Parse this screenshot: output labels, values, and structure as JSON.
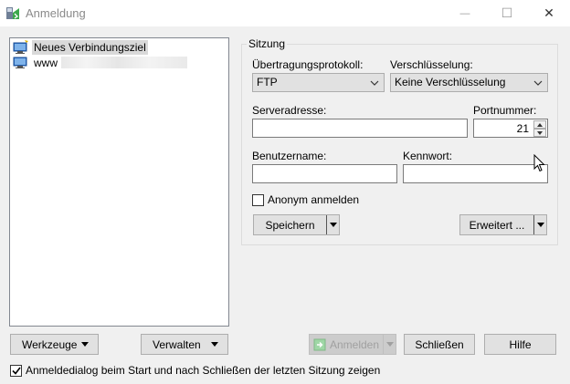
{
  "window": {
    "title": "Anmeldung",
    "minimize_glyph": "—",
    "maximize_glyph": "☐",
    "close_glyph": "✕"
  },
  "site_tree": {
    "items": [
      {
        "label": "Neues Verbindungsziel",
        "icon": "new-site-icon",
        "selected": true
      },
      {
        "label": "www",
        "icon": "computer-icon",
        "selected": false
      }
    ]
  },
  "session": {
    "group_label": "Sitzung",
    "protocol_label": "Übertragungsprotokoll:",
    "protocol_value": "FTP",
    "encryption_label": "Verschlüsselung:",
    "encryption_value": "Keine Verschlüsselung",
    "host_label": "Serveradresse:",
    "host_value": "",
    "port_label": "Portnummer:",
    "port_value": "21",
    "user_label": "Benutzername:",
    "user_value": "",
    "password_label": "Kennwort:",
    "password_value": "",
    "anonymous_label": "Anonym anmelden",
    "anonymous_checked": false,
    "save_label": "Speichern",
    "advanced_label": "Erweitert ..."
  },
  "footer": {
    "tools_label": "Werkzeuge",
    "manage_label": "Verwalten",
    "login_label": "Anmelden",
    "close_label": "Schließen",
    "help_label": "Hilfe",
    "show_dialog_label": "Anmeldedialog beim Start und nach Schließen der letzten Sitzung zeigen",
    "show_dialog_checked": true
  },
  "colors": {
    "accent_green": "#3aa84a",
    "monitor_blue": "#2a6fc9"
  }
}
